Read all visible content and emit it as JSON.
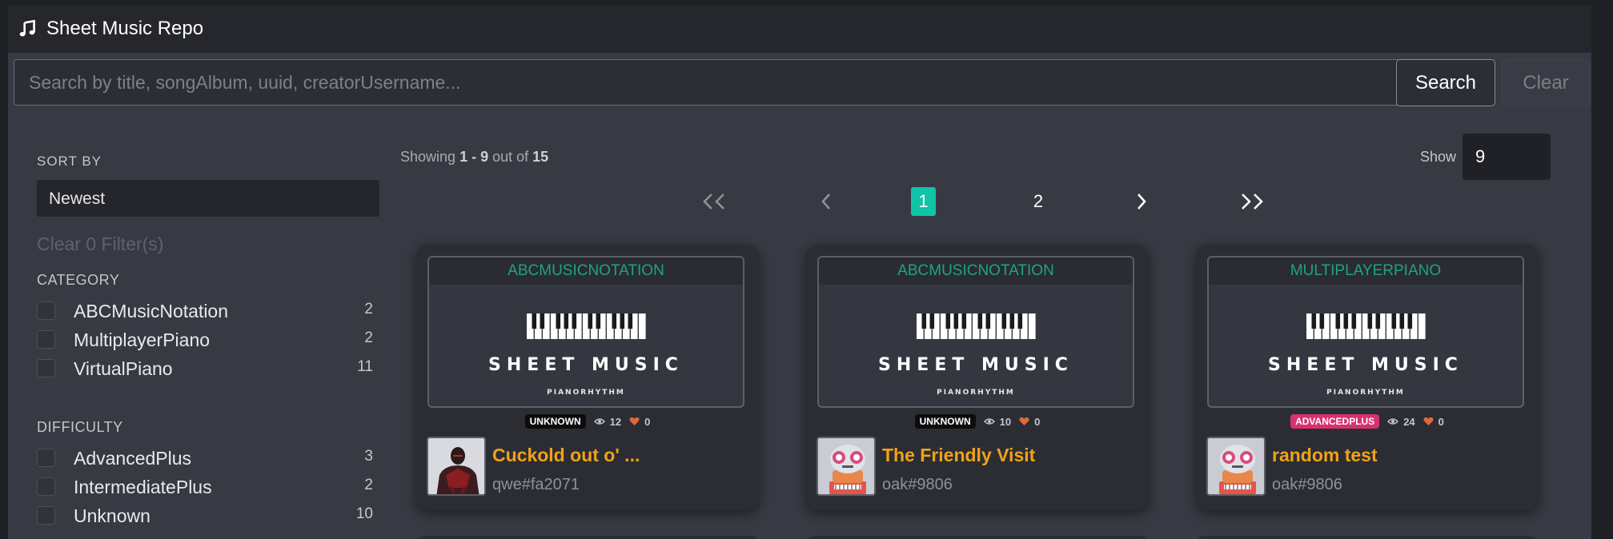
{
  "app": {
    "title": "Sheet Music Repo"
  },
  "search": {
    "placeholder": "Search by title, songAlbum, uuid, creatorUsername...",
    "value": "",
    "search_label": "Search",
    "clear_label": "Clear"
  },
  "sidebar": {
    "sort_by_label": "SORT BY",
    "sort_value": "Newest",
    "clear_filters_label": "Clear 0 Filter(s)",
    "category_label": "CATEGORY",
    "categories": [
      {
        "label": "ABCMusicNotation",
        "count": "2"
      },
      {
        "label": "MultiplayerPiano",
        "count": "2"
      },
      {
        "label": "VirtualPiano",
        "count": "11"
      }
    ],
    "difficulty_label": "DIFFICULTY",
    "difficulties": [
      {
        "label": "AdvancedPlus",
        "count": "3"
      },
      {
        "label": "IntermediatePlus",
        "count": "2"
      },
      {
        "label": "Unknown",
        "count": "10"
      }
    ]
  },
  "results": {
    "showing_prefix": "Showing ",
    "range": "1 - 9",
    "out_of_text": " out of ",
    "total": "15",
    "show_label": "Show",
    "show_value": "9"
  },
  "pagination": {
    "pages": [
      "1",
      "2"
    ],
    "current": "1"
  },
  "cards": [
    {
      "category": "ABCMUSICNOTATION",
      "banner_title": "SHEET MUSIC",
      "banner_sub": "PIANORHYTHM",
      "difficulty": "UNKNOWN",
      "views": "12",
      "likes": "0",
      "title": "Cuckold out o' ...",
      "creator": "qwe#fa2071"
    },
    {
      "category": "ABCMUSICNOTATION",
      "banner_title": "SHEET MUSIC",
      "banner_sub": "PIANORHYTHM",
      "difficulty": "UNKNOWN",
      "views": "10",
      "likes": "0",
      "title": "The Friendly Visit",
      "creator": "oak#9806"
    },
    {
      "category": "MULTIPLAYERPIANO",
      "banner_title": "SHEET MUSIC",
      "banner_sub": "PIANORHYTHM",
      "difficulty": "ADVANCEDPLUS",
      "views": "24",
      "likes": "0",
      "title": "random test",
      "creator": "oak#9806"
    }
  ],
  "colors": {
    "accent": "#0fc5a6",
    "title_orange": "#f0a21a",
    "category_teal": "#1ea28a",
    "advanced_badge": "#d9306f",
    "heart": "#e0683d"
  },
  "icons": [
    "music-note-icon",
    "first-page-icon",
    "prev-page-icon",
    "next-page-icon",
    "last-page-icon",
    "eye-icon",
    "heart-icon"
  ]
}
